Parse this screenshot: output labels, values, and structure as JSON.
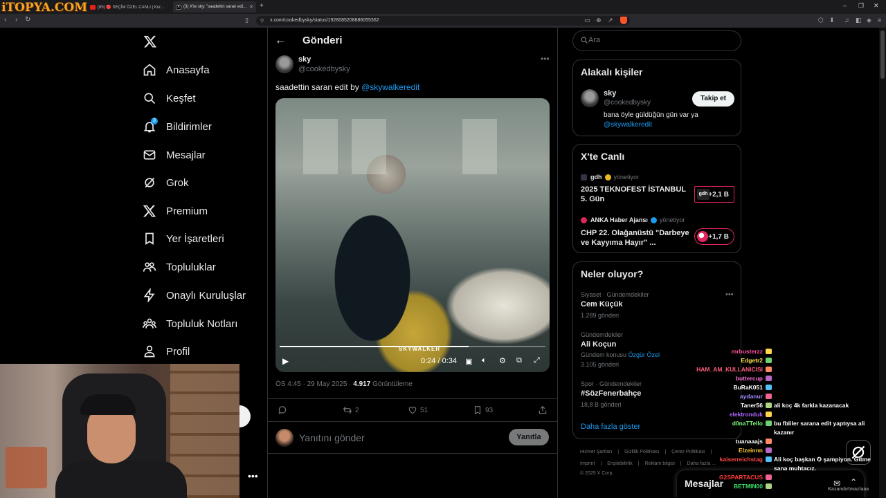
{
  "browser": {
    "watermark": "iTOPYA.COM",
    "tabs": [
      {
        "label": "(85) 🔴 SEÇİM ÖZEL CANLI | Kur..."
      },
      {
        "label": "(3) X'te sky: \"saadettin saran edi..."
      }
    ],
    "new_tab": "+",
    "url": "x.com/cookedbysky/status/1928085208886055362"
  },
  "nav": {
    "items": [
      {
        "label": "Anasayfa"
      },
      {
        "label": "Keşfet"
      },
      {
        "label": "Bildirimler",
        "badge": "3"
      },
      {
        "label": "Mesajlar"
      },
      {
        "label": "Grok"
      },
      {
        "label": "Premium"
      },
      {
        "label": "Yer İşaretleri"
      },
      {
        "label": "Topluluklar"
      },
      {
        "label": "Onaylı Kuruluşlar"
      },
      {
        "label": "Topluluk Notları"
      },
      {
        "label": "Profil"
      }
    ]
  },
  "post": {
    "header_title": "Gönderi",
    "author_name": "sky",
    "author_handle": "@cookedbysky",
    "text": "saadettin saran edit by ",
    "mention": "@skywalkeredit",
    "video": {
      "caption": "SKYWALKER",
      "time": "0:24 / 0:34",
      "progress": 0.71
    },
    "time_label": "ÖS 4:45 · 29 May 2025 · ",
    "views": "4.917",
    "views_label": " Görüntüleme",
    "stats": {
      "replies": "",
      "reposts": "2",
      "likes": "51",
      "bookmarks": "93"
    },
    "reply_placeholder": "Yanıtını gönder",
    "reply_button": "Yanıtla"
  },
  "sidebar": {
    "search_placeholder": "Ara",
    "related": {
      "title": "Alakalı kişiler",
      "name": "sky",
      "handle": "@cookedbysky",
      "bio": "bana öyle güldüğün gün var ya ",
      "bio_mention": "@skywalkeredit",
      "follow": "Takip et"
    },
    "live": {
      "title": "X'te Canlı",
      "items": [
        {
          "host": "gdh",
          "sub": "yönetiyor",
          "title": "2025 TEKNOFEST İSTANBUL 5. Gün",
          "count": "+2,1 B",
          "avatar_text": "gdh"
        },
        {
          "host": "ANKA Haber Ajansı",
          "sub": "yönetiyor",
          "title": "CHP 22. Olağanüstü \"Darbeye ve Kayyıma Hayır\" ...",
          "count": "+1,7 B"
        }
      ]
    },
    "trends": {
      "title": "Neler oluyor?",
      "items": [
        {
          "meta": "Siyaset · Gündemdekiler",
          "name": "Cem Küçük",
          "count": "1.289 gönderi"
        },
        {
          "meta": "Gündemdekiler",
          "name": "Ali Koçun",
          "context_prefix": "Gündem konusu ",
          "context_link": "Özgür Özel",
          "count": "3.105 gönderi"
        },
        {
          "meta": "Spor · Gündemdekiler",
          "name": "#SözFenerbahçe",
          "count": "18,8 B gönderi"
        }
      ],
      "show_more": "Daha fazla göster"
    },
    "footer": {
      "line1": [
        "Hizmet Şartları",
        "|",
        "Gizlilik Politikası",
        "|",
        "Çerez Politikası",
        "|"
      ],
      "line2": [
        "Imprint",
        "|",
        "Erişilebilirlik",
        "|",
        "Reklam bilgisi",
        "|",
        "Daha fazla ..."
      ],
      "copyright": "© 2025 X Corp."
    },
    "messages_drawer": "Mesajlar"
  },
  "chat": {
    "messages": [
      {
        "user": "mrbusterzz",
        "color": "#ff4fa3",
        "msg": ""
      },
      {
        "user": "Edgetr2",
        "color": "#ffe34a",
        "msg": ""
      },
      {
        "user": "HAM_AM_KULLANICISI",
        "color": "#ff5e7e",
        "msg": ""
      },
      {
        "user": "buttercup",
        "color": "#ff6fd6",
        "msg": ""
      },
      {
        "user": "BuRaK051",
        "color": "#ffffff",
        "msg": ""
      },
      {
        "user": "aydanur",
        "color": "#a58bff",
        "msg": ""
      },
      {
        "user": "Taner56",
        "color": "#ffffff",
        "msg": "ali koç 4k farkla kazanacak"
      },
      {
        "user": "elektronduk",
        "color": "#b266ff",
        "msg": ""
      },
      {
        "user": "d0naTTello",
        "color": "#7dff7d",
        "msg": "bu fbliler sarana edit yaptıysa ali kazanır"
      },
      {
        "user": "tuanaaajs",
        "color": "#ffffff",
        "msg": ""
      },
      {
        "user": "Elzeinnn",
        "color": "#ffcc33",
        "msg": ""
      },
      {
        "user": "kaiserreichstag",
        "color": "#ff4747",
        "msg": "Ali koç başkan ✪ şampiyon. Gitme sana muhtacız."
      },
      {
        "user": "G2SPARTACUS",
        "color": "#ff3b3b",
        "msg": ""
      },
      {
        "user": "BETMIN00",
        "color": "#39e06b",
        "msg": ""
      }
    ],
    "watermark": "Kazandırtmazlaaa"
  },
  "colors": {
    "accent": "#1d9bf0",
    "live": "#e0245e",
    "border": "#2f3336"
  }
}
